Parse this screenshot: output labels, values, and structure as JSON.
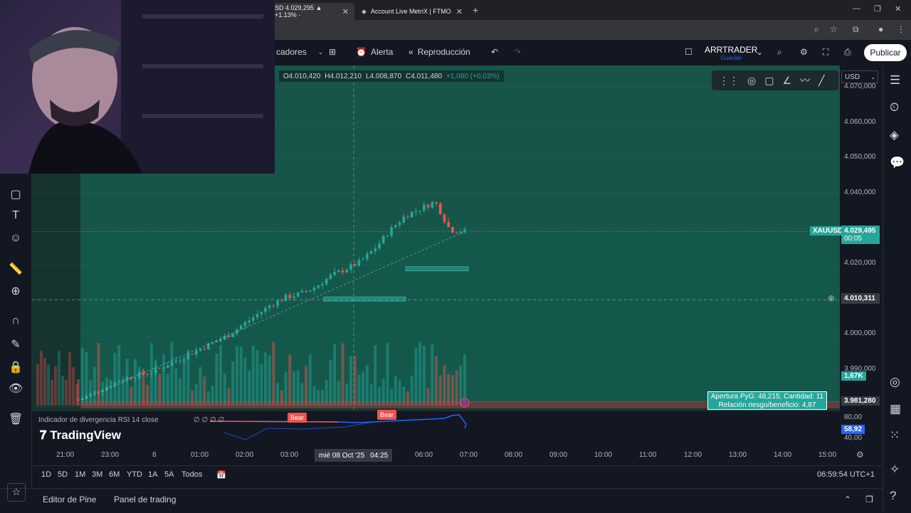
{
  "browser": {
    "tabs": [
      {
        "label": "SD 4.029,295 ▲ +1.13% ·"
      },
      {
        "label": "Account Live MetriX | FTMO"
      }
    ]
  },
  "toolbar": {
    "indicators_label": "cadores",
    "alert_label": "Alerta",
    "replay_label": "Reproducción",
    "layout_name": "ARRTRADER",
    "layout_save": "Guardar",
    "publish_label": "Publicar"
  },
  "legend": {
    "open": "O4.010,420",
    "high": "H4.012,210",
    "low": "L4.008,870",
    "close": "C4.011,480",
    "change": "+1,080 (+0,03%)"
  },
  "currency": "USD",
  "price_axis": {
    "ticks": [
      "4.070,000",
      "4.060,000",
      "4.050,000",
      "4.040,000",
      "4.020,000",
      "4.000,000",
      "3.990,000"
    ],
    "symbol_label": "XAUUSD",
    "last_price": "4.029,495",
    "countdown": "00:05",
    "crosshair_price": "4.010,311",
    "volume_label": "1,67K",
    "low_label": "3.981,280",
    "rsi_ticks": [
      "80,00",
      "40,00"
    ],
    "rsi_value": "58,92"
  },
  "pnl_box": {
    "line1": "Apertura PyG: 48,215, Cantidad: 11",
    "line2": "Relación riesgo/beneficio: 4,87"
  },
  "rsi": {
    "name": "Indicador de divergencia RSI 14 close",
    "values": "∅ ∅ ∅ ∅",
    "labels": [
      "Bear",
      "Bear"
    ]
  },
  "brand": "TradingView",
  "time_axis": {
    "ticks": [
      "21:00",
      "23:00",
      "8",
      "01:00",
      "02:00",
      "03:00",
      "06:00",
      "07:00",
      "08:00",
      "09:00",
      "10:00",
      "11:00",
      "12:00",
      "13:00",
      "14:00",
      "15:00"
    ],
    "crosshair_date": "mié 08 Oct '25",
    "crosshair_time": "04:25"
  },
  "ranges": [
    "1D",
    "5D",
    "1M",
    "3M",
    "6M",
    "YTD",
    "1A",
    "5A",
    "Todos"
  ],
  "clock": "06:59:54 UTC+1",
  "bottom_tabs": [
    "Editor de Pine",
    "Panel de trading"
  ],
  "colors": {
    "up": "#26a69a",
    "down": "#ef5350",
    "zone": "#175548",
    "accent": "#2962ff"
  },
  "chart_data": {
    "type": "candlestick",
    "symbol": "XAUUSD",
    "ylim": [
      3980,
      4072
    ],
    "x_categories": [
      "21:00",
      "23:00",
      "8",
      "01:00",
      "02:00",
      "03:00",
      "04:25",
      "06:00",
      "07:00"
    ],
    "close_path": [
      3982,
      3984,
      3986,
      3988,
      3989,
      3990,
      3992,
      3994,
      3996,
      3998,
      4000,
      4003,
      4006,
      4009,
      4011,
      4012,
      4014,
      4017,
      4019,
      4021,
      4025,
      4030,
      4034,
      4036,
      4038,
      4030,
      4029.5
    ],
    "last_price": 4029.495,
    "crosshair_price": 4010.311
  }
}
